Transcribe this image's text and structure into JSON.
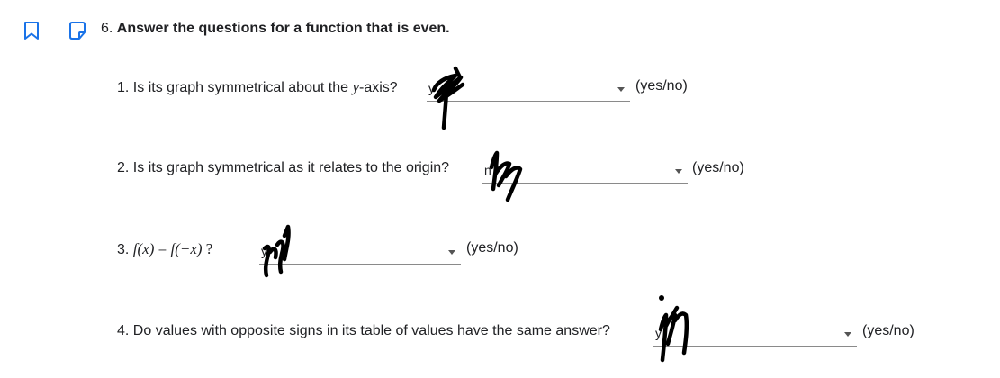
{
  "question": {
    "number": "6.",
    "title": "Answer the questions for a function that is even."
  },
  "items": [
    {
      "num": "1.",
      "text_before": "Is its graph symmetrical about the ",
      "math": "y",
      "text_after": "-axis?",
      "selected": "y",
      "hint": "(yes/no)"
    },
    {
      "num": "2.",
      "text": "Is its graph symmetrical as it relates to the origin?",
      "selected": "n",
      "hint": "(yes/no)"
    },
    {
      "num": "3.",
      "math_a": "f(x)",
      "eq": " = ",
      "math_b": "f(−x)",
      "q": " ?",
      "selected": "y",
      "hint": "(yes/no)"
    },
    {
      "num": "4.",
      "text": "Do values with opposite signs in its table of values have the same answer?",
      "selected": "y",
      "hint": "(yes/no)"
    }
  ],
  "icons": {
    "bookmark": "bookmark-icon",
    "note": "note-icon",
    "accent": "#1a73e8"
  }
}
